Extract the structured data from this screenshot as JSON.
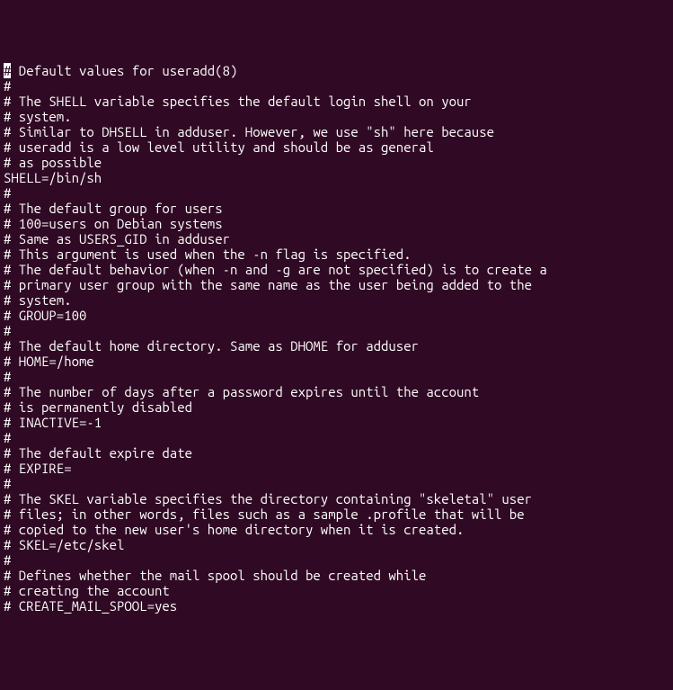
{
  "lines": [
    {
      "cursor": true,
      "text": " Default values for useradd(8)"
    },
    {
      "text": "#"
    },
    {
      "text": "# The SHELL variable specifies the default login shell on your"
    },
    {
      "text": "# system."
    },
    {
      "text": "# Similar to DHSELL in adduser. However, we use \"sh\" here because"
    },
    {
      "text": "# useradd is a low level utility and should be as general"
    },
    {
      "text": "# as possible"
    },
    {
      "text": "SHELL=/bin/sh"
    },
    {
      "text": "#"
    },
    {
      "text": "# The default group for users"
    },
    {
      "text": "# 100=users on Debian systems"
    },
    {
      "text": "# Same as USERS_GID in adduser"
    },
    {
      "text": "# This argument is used when the -n flag is specified."
    },
    {
      "text": "# The default behavior (when -n and -g are not specified) is to create a"
    },
    {
      "text": "# primary user group with the same name as the user being added to the"
    },
    {
      "text": "# system."
    },
    {
      "text": "# GROUP=100"
    },
    {
      "text": "#"
    },
    {
      "text": "# The default home directory. Same as DHOME for adduser"
    },
    {
      "text": "# HOME=/home"
    },
    {
      "text": "#"
    },
    {
      "text": "# The number of days after a password expires until the account"
    },
    {
      "text": "# is permanently disabled"
    },
    {
      "text": "# INACTIVE=-1"
    },
    {
      "text": "#"
    },
    {
      "text": "# The default expire date"
    },
    {
      "text": "# EXPIRE="
    },
    {
      "text": "#"
    },
    {
      "text": "# The SKEL variable specifies the directory containing \"skeletal\" user"
    },
    {
      "text": "# files; in other words, files such as a sample .profile that will be"
    },
    {
      "text": "# copied to the new user's home directory when it is created."
    },
    {
      "text": "# SKEL=/etc/skel"
    },
    {
      "text": "#"
    },
    {
      "text": "# Defines whether the mail spool should be created while"
    },
    {
      "text": "# creating the account"
    },
    {
      "text": "# CREATE_MAIL_SPOOL=yes"
    }
  ],
  "cursor_char": "#"
}
